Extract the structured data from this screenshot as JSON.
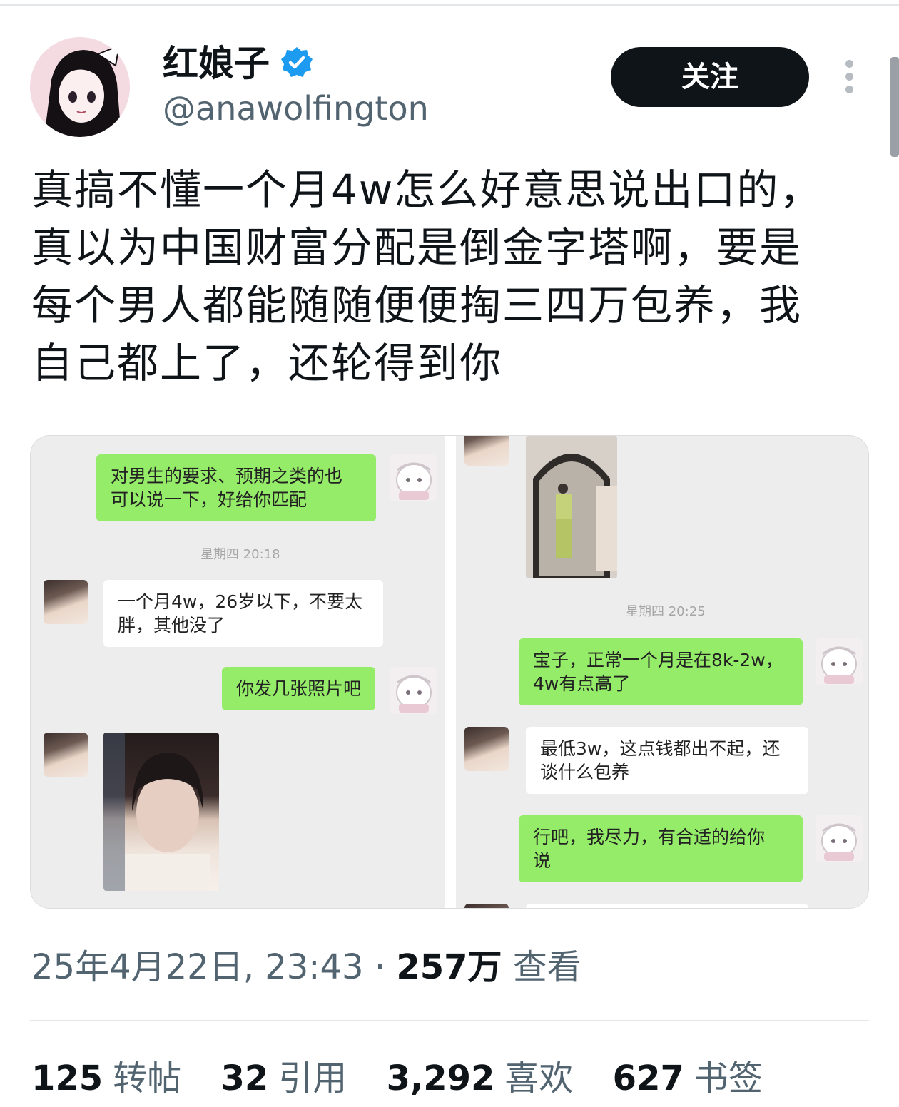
{
  "author": {
    "name": "红娘子",
    "handle": "@anawolfington"
  },
  "follow_label": "关注",
  "tweet_lines": [
    "真搞不懂一个月4w怎么好意思说出口的，",
    "真以为中国财富分配是倒金字塔啊，要是",
    "每个男人都能随随便便掏三四万包养，我",
    "自己都上了，还轮得到你"
  ],
  "chat_left": {
    "msg1": "对男生的要求、预期之类的也\n可以说一下，好给你匹配",
    "time1": "星期四 20:18",
    "msg2": "一个月4w，26岁以下，不要太\n胖，其他没了",
    "msg3": "你发几张照片吧"
  },
  "chat_right": {
    "time1": "星期四 20:25",
    "msg1": "宝子，正常一个月是在8k-2w，\n4w有点高了",
    "msg2": "最低3w，这点钱都出不起，还\n谈什么包养",
    "msg3": "行吧，我尽力，有合适的给你\n说"
  },
  "meta": {
    "date": "25年4月22日, 23:43",
    "sep": "·",
    "views": "257万",
    "views_label": "查看"
  },
  "stats": {
    "reposts": "125",
    "reposts_label": "转帖",
    "quotes": "32",
    "quotes_label": "引用",
    "likes": "3,292",
    "likes_label": "喜欢",
    "bookmarks": "627",
    "bookmarks_label": "书签"
  },
  "colors": {
    "verified": "#1d9bf0",
    "chat_green": "#95ec69",
    "follow_bg": "#0f1419"
  }
}
